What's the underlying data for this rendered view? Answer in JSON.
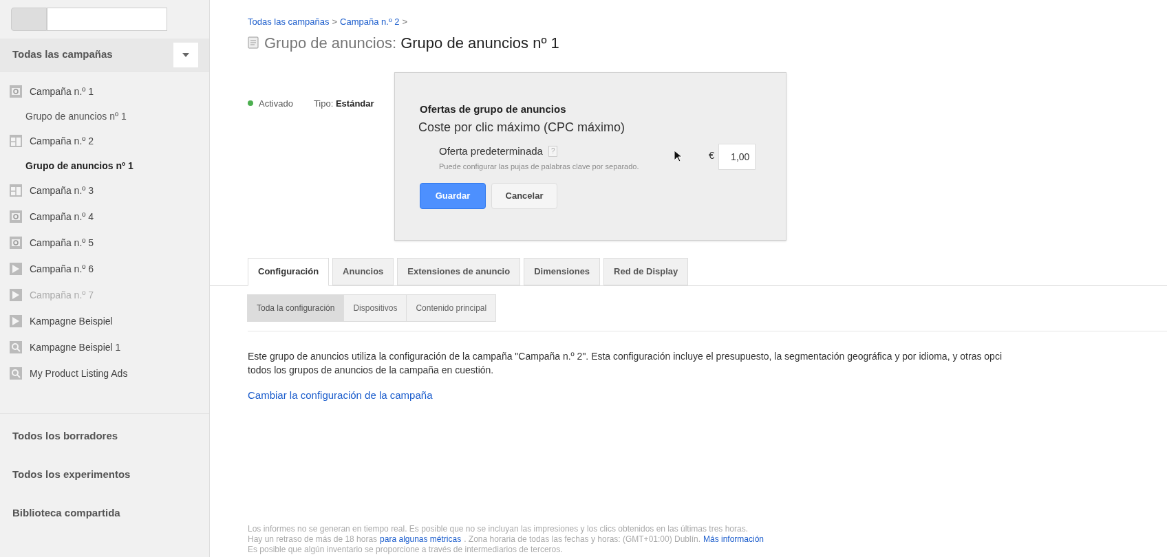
{
  "sidebar": {
    "header": "Todas las campañas",
    "items": [
      {
        "label": "Campaña n.º 1",
        "kind": "display",
        "disabled": false,
        "selected": false,
        "children": [
          {
            "label": "Grupo de anuncios nº 1",
            "selected": false
          }
        ]
      },
      {
        "label": "Campaña n.º 2",
        "kind": "columns",
        "disabled": false,
        "selected": false,
        "children": [
          {
            "label": "Grupo de anuncios nº 1",
            "selected": true
          }
        ]
      },
      {
        "label": "Campaña n.º 3",
        "kind": "columns",
        "disabled": false,
        "selected": false
      },
      {
        "label": "Campaña n.º 4",
        "kind": "display",
        "disabled": false,
        "selected": false
      },
      {
        "label": "Campaña n.º 5",
        "kind": "display",
        "disabled": false,
        "selected": false
      },
      {
        "label": "Campaña n.º 6",
        "kind": "video",
        "disabled": false,
        "selected": false
      },
      {
        "label": "Campaña n.º 7",
        "kind": "video",
        "disabled": true,
        "selected": false
      },
      {
        "label": "Kampagne Beispiel",
        "kind": "video",
        "disabled": false,
        "selected": false
      },
      {
        "label": "Kampagne Beispiel 1",
        "kind": "search",
        "disabled": false,
        "selected": false
      },
      {
        "label": "My Product Listing Ads",
        "kind": "search",
        "disabled": false,
        "selected": false
      }
    ],
    "footer_links": [
      "Todos los borradores",
      "Todos los experimentos",
      "Biblioteca compartida"
    ]
  },
  "breadcrumb": [
    "Todas las campañas",
    "Campaña n.º 2"
  ],
  "breadcrumb_separator": ">",
  "title": {
    "prefix": "Grupo de anuncios:",
    "name": "Grupo de anuncios nº 1"
  },
  "status": {
    "label": "Activado",
    "color": "#4caf50"
  },
  "type": {
    "label": "Tipo:",
    "value": "Estándar"
  },
  "bid_popup": {
    "heading": "Ofertas de grupo de anuncios",
    "subheading": "Coste por clic máximo (CPC máximo)",
    "field_label": "Oferta predeterminada",
    "help": "?",
    "hint": "Puede configurar las pujas de palabras clave por separado.",
    "currency": "€",
    "value": "1,00",
    "buttons": [
      {
        "label": "Guardar",
        "kind": "primary"
      },
      {
        "label": "Cancelar",
        "kind": "secondary"
      }
    ]
  },
  "tabs": [
    {
      "label": "Configuración",
      "selected": true
    },
    {
      "label": "Anuncios",
      "selected": false
    },
    {
      "label": "Extensiones de anuncio",
      "selected": false
    },
    {
      "label": "Dimensiones",
      "selected": false
    },
    {
      "label": "Red de Display",
      "selected": false
    }
  ],
  "subtabs": [
    {
      "label": "Toda la configuración",
      "selected": true
    },
    {
      "label": "Dispositivos",
      "selected": false
    },
    {
      "label": "Contenido principal",
      "selected": false
    }
  ],
  "info_text": "Este grupo de anuncios utiliza la configuración de la campaña \"Campaña n.º 2\". Esta configuración incluye el presupuesto, la segmentación geográfica y por idioma, y otras opci",
  "info_text_2": "todos los grupos de anuncios de la campaña en cuestión.",
  "change_link": "Cambiar la configuración de la campaña",
  "footer": [
    [
      {
        "kind": "text",
        "text": "Los informes no se generan en tiempo real. Es posible que no se incluyan las impresiones y los clics obtenidos en las últimas tres horas."
      }
    ],
    [
      {
        "kind": "text",
        "text": "Hay un retraso de más de 18 horas"
      },
      {
        "kind": "link",
        "text": "para algunas métricas"
      },
      {
        "kind": "text",
        "text": ". Zona horaria de todas las fechas y horas: (GMT+01:00) Dublín."
      },
      {
        "kind": "link",
        "text": "Más información"
      }
    ],
    [
      {
        "kind": "text",
        "text": "Es posible que algún inventario se proporcione a través de intermediarios de terceros."
      }
    ]
  ]
}
